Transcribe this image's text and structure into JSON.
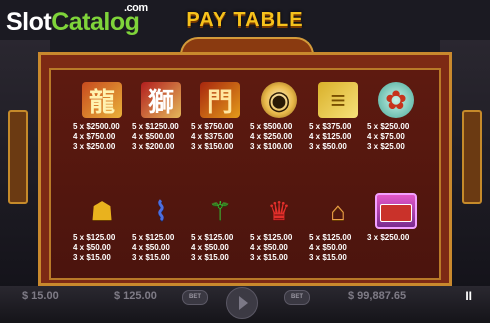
{
  "logo": {
    "slot": "Slot",
    "catalog": "Catalog",
    "com": ".com"
  },
  "header": {
    "title": "PAY TABLE"
  },
  "symbols_row1": [
    {
      "icon": "dragon-icon",
      "glyph": "龍",
      "pays": [
        "5 x $2500.00",
        "4 x $750.00",
        "3 x $250.00"
      ]
    },
    {
      "icon": "lion-icon",
      "glyph": "獅",
      "pays": [
        "5 x $1250.00",
        "4 x $500.00",
        "3 x $200.00"
      ]
    },
    {
      "icon": "temple-icon",
      "glyph": "門",
      "pays": [
        "5 x $750.00",
        "4 x $375.00",
        "3 x $150.00"
      ]
    },
    {
      "icon": "coin-icon",
      "glyph": "◉",
      "pays": [
        "5 x $500.00",
        "4 x $250.00",
        "3 x $100.00"
      ]
    },
    {
      "icon": "gold-scroll-icon",
      "glyph": "≡",
      "pays": [
        "5 x $375.00",
        "4 x $125.00",
        "3 x $50.00"
      ]
    },
    {
      "icon": "vase-icon",
      "glyph": "✿",
      "pays": [
        "5 x $250.00",
        "4 x $75.00",
        "3 x $25.00"
      ]
    }
  ],
  "symbols_row2": [
    {
      "icon": "mahjong-gold-icon",
      "glyph": "☗",
      "pays": [
        "5 x $125.00",
        "4 x $50.00",
        "3 x $15.00"
      ]
    },
    {
      "icon": "mahjong-blue-icon",
      "glyph": "⌇",
      "pays": [
        "5 x $125.00",
        "4 x $50.00",
        "3 x $15.00"
      ]
    },
    {
      "icon": "mahjong-green-icon",
      "glyph": "⚚",
      "pays": [
        "5 x $125.00",
        "4 x $50.00",
        "3 x $15.00"
      ]
    },
    {
      "icon": "mahjong-red-icon",
      "glyph": "♛",
      "pays": [
        "5 x $125.00",
        "4 x $50.00",
        "3 x $15.00"
      ]
    },
    {
      "icon": "mahjong-orange-icon",
      "glyph": "⌂",
      "pays": [
        "5 x $125.00",
        "4 x $50.00",
        "3 x $15.00"
      ]
    },
    {
      "icon": "scatter-bus-icon",
      "glyph": "",
      "pays": [
        "3 x $250.00"
      ]
    }
  ],
  "bottom": {
    "balance_left": "$ 15.00",
    "bet_value": "$ 125.00",
    "bet_label": "BET",
    "credit": "$ 99,887.65",
    "pause": "II"
  }
}
